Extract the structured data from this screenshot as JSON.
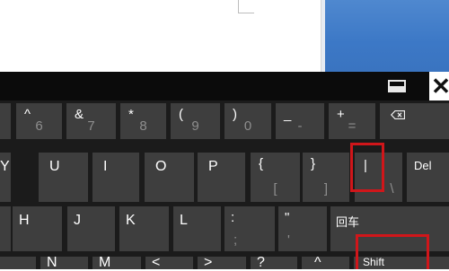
{
  "keyboard": {
    "close_label": "✕",
    "row1": [
      {
        "top": "",
        "bottom": ""
      },
      {
        "top": "^",
        "bottom": "6"
      },
      {
        "top": "&",
        "bottom": "7"
      },
      {
        "top": "*",
        "bottom": "8"
      },
      {
        "top": "(",
        "bottom": "9"
      },
      {
        "top": ")",
        "bottom": "0"
      },
      {
        "top": "_",
        "bottom": "-"
      },
      {
        "top": "+",
        "bottom": "="
      }
    ],
    "row2": [
      {
        "label": "Y"
      },
      {
        "label": "U"
      },
      {
        "label": "I"
      },
      {
        "label": "O"
      },
      {
        "label": "P"
      },
      {
        "top": "{",
        "bottom": "["
      },
      {
        "top": "}",
        "bottom": "]"
      },
      {
        "top": "|",
        "bottom": "\\"
      },
      {
        "label": "Del"
      }
    ],
    "row3": [
      {
        "label": ""
      },
      {
        "label": "H"
      },
      {
        "label": "J"
      },
      {
        "label": "K"
      },
      {
        "label": "L"
      },
      {
        "top": ":",
        "bottom": ";"
      },
      {
        "top": "\"",
        "bottom": "'"
      },
      {
        "label": "回车"
      }
    ],
    "row4": [
      {
        "label": ""
      },
      {
        "label": "N"
      },
      {
        "label": "M"
      },
      {
        "label": "<"
      },
      {
        "label": ">"
      },
      {
        "label": "?"
      },
      {
        "label": "^"
      },
      {
        "label": "Shift"
      }
    ]
  }
}
